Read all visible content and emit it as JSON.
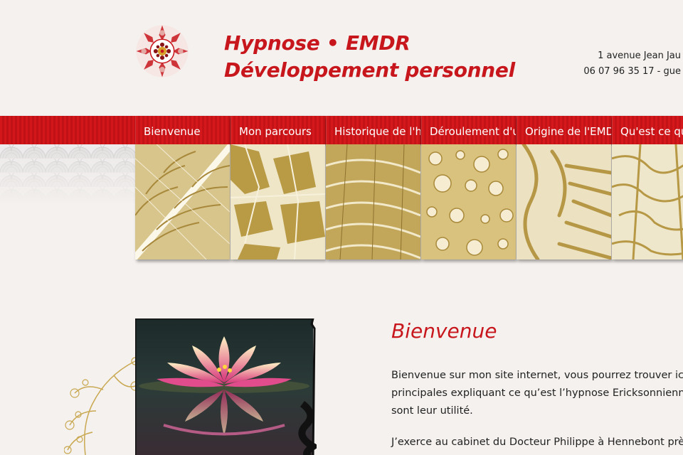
{
  "header": {
    "title_line1": "Hypnose • EMDR",
    "title_line2": "Développement personnel",
    "contact_line1": "1 avenue Jean Jau",
    "contact_line2": "06 07 96 35 17 - gue"
  },
  "nav": {
    "items": [
      {
        "label": "Bienvenue"
      },
      {
        "label": "Mon parcours"
      },
      {
        "label": "Historique de l'hypnose"
      },
      {
        "label": "Déroulement d'une séance"
      },
      {
        "label": "Origine de l'EMDR"
      },
      {
        "label": "Qu'est ce que l'EMDR"
      }
    ]
  },
  "main": {
    "heading": "Bienvenue",
    "paragraph1_line1": "Bienvenue sur mon site internet, vous pourrez trouver ici",
    "paragraph1_line2": "principales expliquant ce qu’est l’hypnose Ericksonnienne",
    "paragraph1_line3": "sont leur utilité.",
    "paragraph2_line1": "J’exerce au cabinet du Docteur Philippe à Hennebont près"
  },
  "colors": {
    "brand_red": "#c8161d",
    "gold": "#b89a4a",
    "background": "#f4f1ee"
  },
  "icons": {
    "logo": "mandala-logo",
    "decoration": "floral-ornament"
  }
}
